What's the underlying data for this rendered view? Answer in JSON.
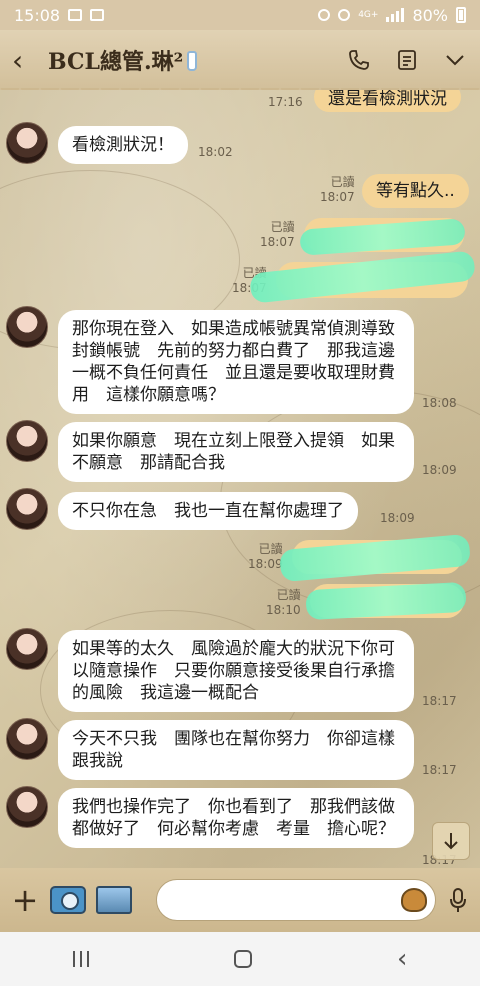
{
  "status": {
    "time": "15:08",
    "network": "4G+",
    "battery": "80%"
  },
  "header": {
    "title": "BCL總管.琳²"
  },
  "messages": [
    {
      "text": "還是看檢測狀況",
      "time": "17:16",
      "dir": "out"
    },
    {
      "text": "看檢測狀況！",
      "time": "18:02",
      "dir": "in"
    },
    {
      "text": "等有點久..",
      "time": "18:07",
      "read": "已讀",
      "dir": "out"
    },
    {
      "text": "",
      "time": "18:07",
      "read": "已讀",
      "dir": "out"
    },
    {
      "text": "",
      "time": "18:07",
      "read": "已讀",
      "dir": "out"
    },
    {
      "text": "那你現在登入　如果造成帳號異常偵測導致封鎖帳號　先前的努力都白費了　那我這邊一概不負任何責任　並且還是要收取理財費用　這樣你願意嗎？",
      "time": "18:08",
      "dir": "in"
    },
    {
      "text": "如果你願意　現在立刻上限登入提領　如果不願意　那請配合我",
      "time": "18:09",
      "dir": "in"
    },
    {
      "text": "不只你在急　我也一直在幫你處理了",
      "time": "18:09",
      "dir": "in"
    },
    {
      "text": "",
      "time": "18:09",
      "read": "已讀",
      "dir": "out"
    },
    {
      "text": "",
      "time": "18:10",
      "read": "已讀",
      "dir": "out"
    },
    {
      "text": "如果等的太久　風險過於龐大的狀況下你可以隨意操作　只要你願意接受後果自行承擔的風險　我這邊一概配合",
      "time": "18:17",
      "dir": "in"
    },
    {
      "text": "今天不只我　團隊也在幫你努力　你卻這樣跟我說",
      "time": "18:17",
      "dir": "in"
    },
    {
      "text": "我們也操作完了　你也看到了　那我們該做都做好了　何必幫你考慮　考量　擔心呢？",
      "time": "18:17",
      "dir": "in"
    }
  ],
  "input": {
    "placeholder": ""
  }
}
